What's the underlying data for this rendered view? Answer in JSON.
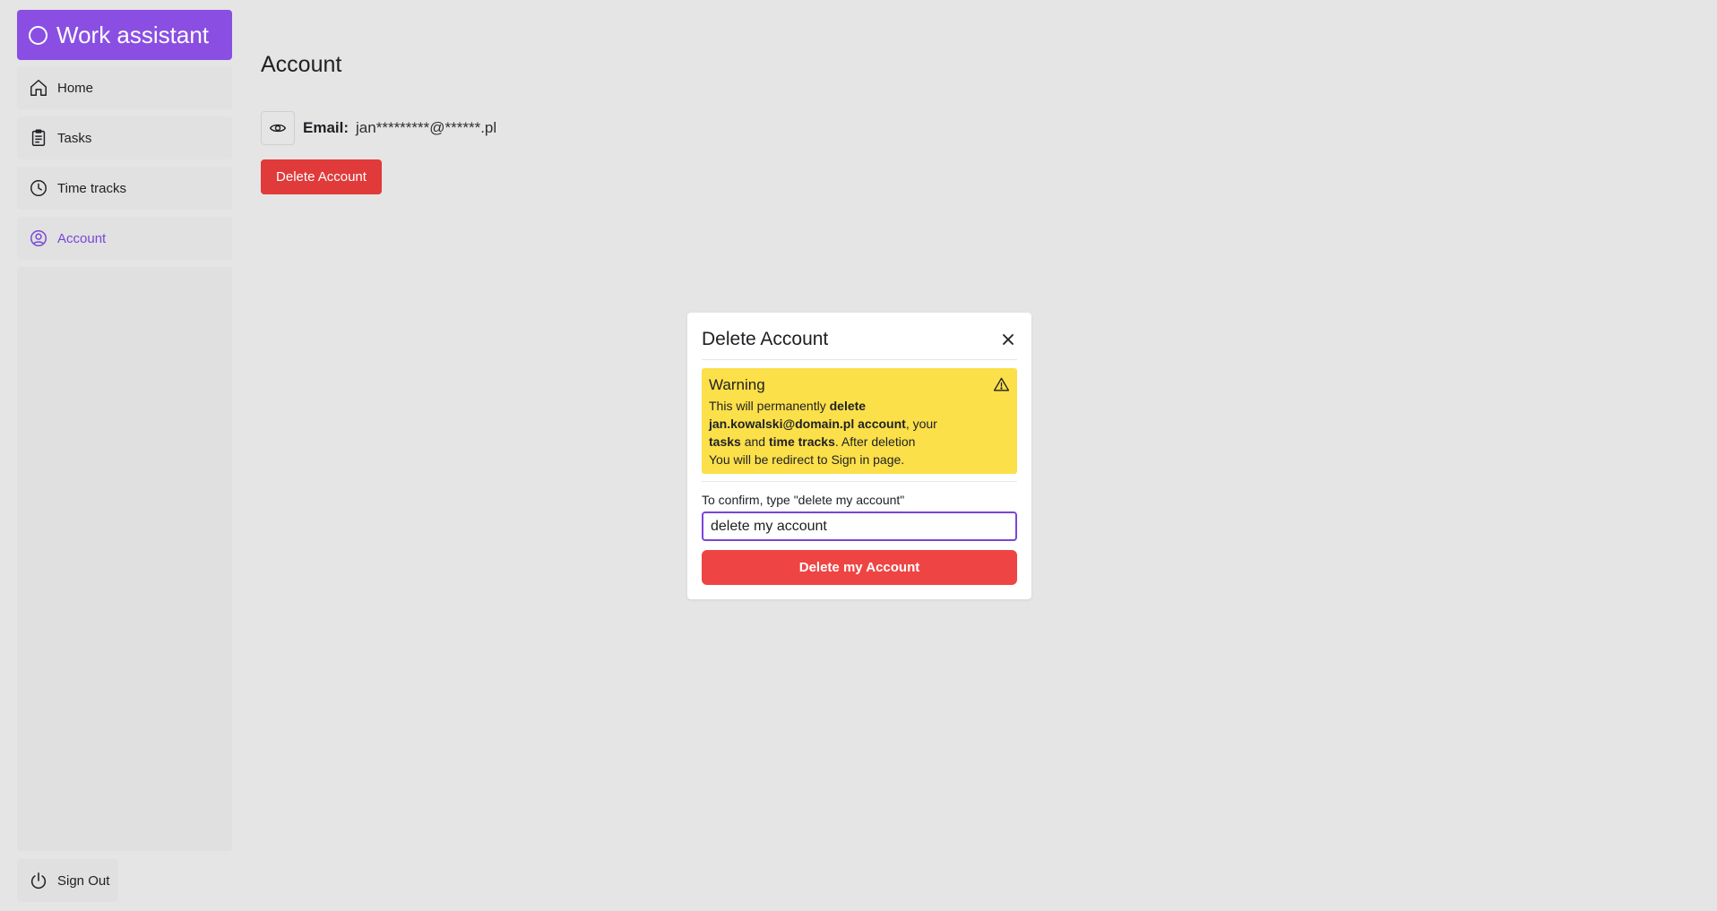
{
  "app": {
    "title": "Work assistant",
    "brand_color": "#8a4fe2"
  },
  "sidebar": {
    "items": [
      {
        "label": "Home",
        "icon": "home-icon"
      },
      {
        "label": "Tasks",
        "icon": "clipboard-icon"
      },
      {
        "label": "Time tracks",
        "icon": "clock-icon"
      },
      {
        "label": "Account",
        "icon": "user-circle-icon",
        "active": true
      }
    ],
    "sign_out": {
      "label": "Sign Out",
      "icon": "power-icon"
    }
  },
  "main": {
    "title": "Account",
    "email_label": "Email:",
    "email_value": "jan*********@******.pl",
    "delete_label": "Delete Account"
  },
  "modal": {
    "title": "Delete Account",
    "warning": {
      "title": "Warning",
      "text_1": "This will permanently ",
      "bold_1": "delete",
      "bold_2": "jan.kowalski@domain.pl account",
      "text_2": ", your",
      "bold_3": "tasks",
      "text_3": " and ",
      "bold_4": "time tracks",
      "text_4": ". After deletion",
      "text_5": "You will be redirect to Sign in page.",
      "color": "#fbe04a"
    },
    "confirm_label": "To confirm, type \"delete my account\"",
    "confirm_value": "delete my account",
    "confirm_button": "Delete my Account",
    "danger_color": "#ef4444"
  }
}
